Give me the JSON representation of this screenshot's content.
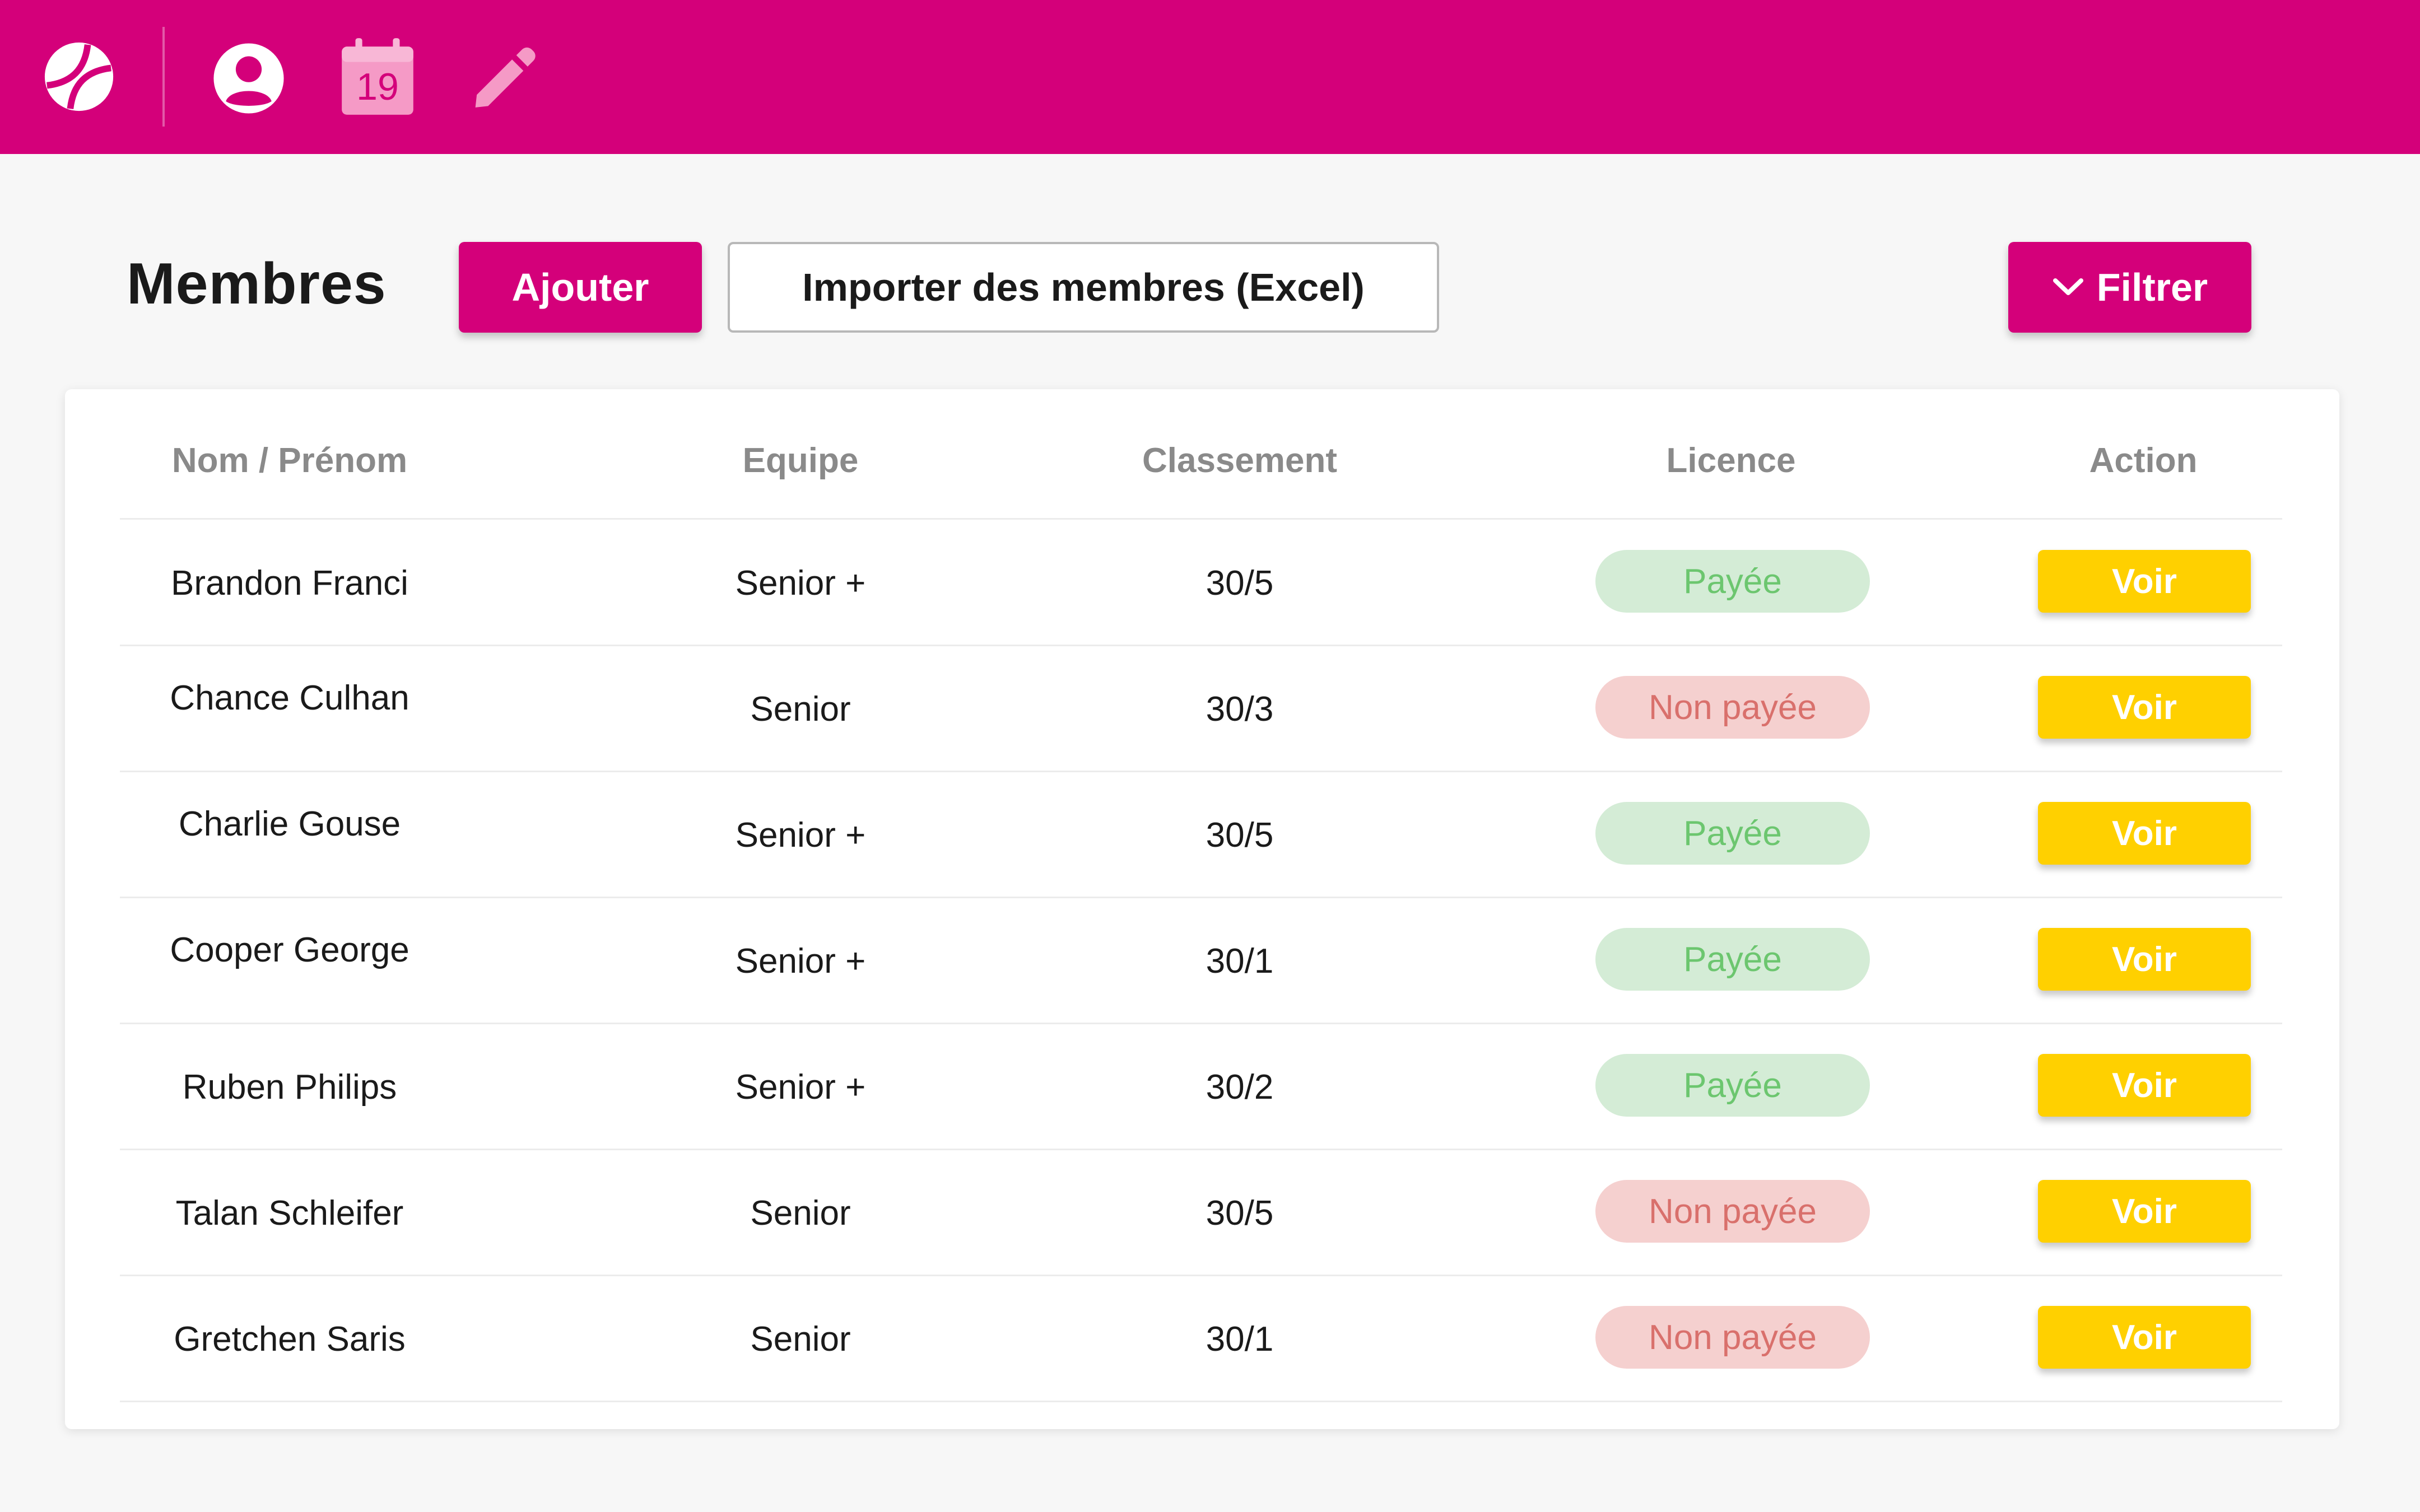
{
  "app": {
    "calendar_day": "19"
  },
  "header": {
    "title": "Membres",
    "add_label": "Ajouter",
    "import_label": "Importer des membres (Excel)",
    "filter_label": "Filtrer"
  },
  "table": {
    "columns": {
      "name": "Nom / Prénom",
      "team": "Equipe",
      "rank": "Classement",
      "license": "Licence",
      "action": "Action"
    },
    "rows": [
      {
        "name": "Brandon Franci",
        "team": "Senior +",
        "rank": "30/5",
        "license": "Payée",
        "status": "paid",
        "action": "Voir"
      },
      {
        "name": "Chance Culhan",
        "team": "Senior",
        "rank": "30/3",
        "license": "Non payée",
        "status": "unpaid",
        "action": "Voir"
      },
      {
        "name": "Charlie Gouse",
        "team": "Senior +",
        "rank": "30/5",
        "license": "Payée",
        "status": "paid",
        "action": "Voir"
      },
      {
        "name": "Cooper George",
        "team": "Senior +",
        "rank": "30/1",
        "license": "Payée",
        "status": "paid",
        "action": "Voir"
      },
      {
        "name": "Ruben Philips",
        "team": "Senior +",
        "rank": "30/2",
        "license": "Payée",
        "status": "paid",
        "action": "Voir"
      },
      {
        "name": "Talan Schleifer",
        "team": "Senior",
        "rank": "30/5",
        "license": "Non payée",
        "status": "unpaid",
        "action": "Voir"
      },
      {
        "name": "Gretchen Saris",
        "team": "Senior",
        "rank": "30/1",
        "license": "Non payée",
        "status": "unpaid",
        "action": "Voir"
      }
    ]
  },
  "colors": {
    "brand": "#d4007a",
    "action": "#ffd000",
    "paid_bg": "#d4ecd6",
    "paid_text": "#6cc66f",
    "unpaid_bg": "#f5d0cf",
    "unpaid_text": "#d9706c"
  },
  "icons": {
    "logo": "tennis-ball-icon",
    "profile": "user-icon",
    "calendar": "calendar-icon",
    "edit": "pencil-icon",
    "filter": "chevron-down-icon"
  }
}
